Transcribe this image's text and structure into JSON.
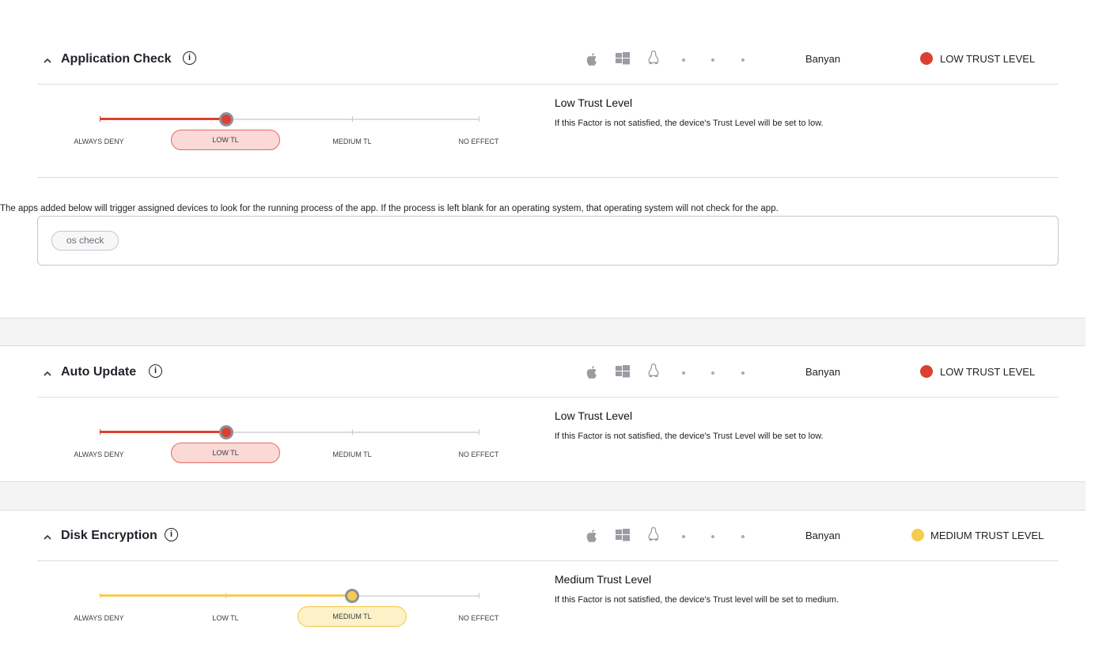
{
  "sections": [
    {
      "title": "Application Check",
      "source": "Banyan",
      "trust_badge": "LOW TRUST LEVEL",
      "trust_color": "#dc4030",
      "steps": [
        "ALWAYS DENY",
        "LOW TL",
        "MEDIUM TL",
        "NO EFFECT"
      ],
      "selected_step": 1,
      "desc_title": "Low Trust Level",
      "desc_text": "If this Factor is not satisfied, the device's Trust Level will be set to low.",
      "apps_note": "The apps added below will trigger assigned devices to look for the running process of the app. If the process is left blank for an operating system, that operating system will not check for the app.",
      "app_chip": "os check"
    },
    {
      "title": "Auto Update",
      "source": "Banyan",
      "trust_badge": "LOW TRUST LEVEL",
      "trust_color": "#dc4030",
      "steps": [
        "ALWAYS DENY",
        "LOW TL",
        "MEDIUM TL",
        "NO EFFECT"
      ],
      "selected_step": 1,
      "desc_title": "Low Trust Level",
      "desc_text": "If this Factor is not satisfied, the device's Trust Level will be set to low."
    },
    {
      "title": "Disk Encryption",
      "source": "Banyan",
      "trust_badge": "MEDIUM TRUST LEVEL",
      "trust_color": "#f6cc50",
      "steps": [
        "ALWAYS DENY",
        "LOW TL",
        "MEDIUM TL",
        "NO EFFECT"
      ],
      "selected_step": 2,
      "desc_title": "Medium Trust Level",
      "desc_text": "If this Factor is not satisfied, the device's Trust level will be set to medium."
    }
  ],
  "icons": {
    "collapse": "chevron-up-icon",
    "info": "info-icon",
    "os": [
      "apple-icon",
      "windows-icon",
      "linux-icon"
    ]
  }
}
